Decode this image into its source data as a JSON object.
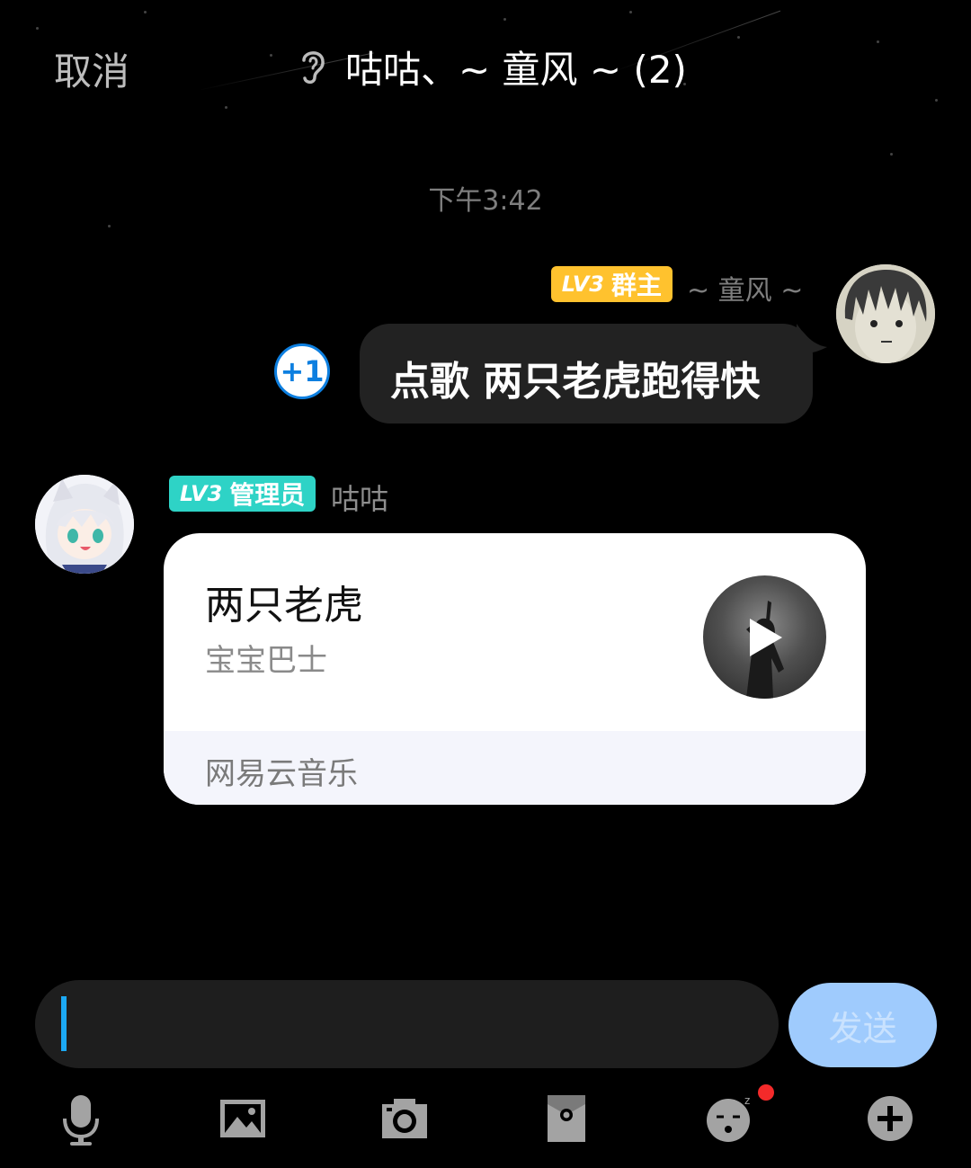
{
  "header": {
    "cancel_label": "取消",
    "title": "咕咕、~ 童风 ~ (2)"
  },
  "timestamp": "下午3:42",
  "messages": {
    "owner": {
      "badge_level": "LV3",
      "badge_role": "群主",
      "name": "~ 童风 ~",
      "text": "点歌 两只老虎跑得快",
      "plus_one": "+1"
    },
    "admin": {
      "badge_level": "LV3",
      "badge_role": "管理员",
      "name": "咕咕",
      "card": {
        "song_title": "两只老虎",
        "artist": "宝宝巴士",
        "source": "网易云音乐"
      }
    }
  },
  "composer": {
    "send_label": "发送"
  },
  "toolbar": {
    "icons": [
      "microphone-icon",
      "image-icon",
      "camera-icon",
      "red-packet-icon",
      "emoji-icon",
      "plus-icon"
    ],
    "emoji_has_notification": true
  },
  "colors": {
    "owner_badge": "#ffc22e",
    "admin_badge": "#2ed3c6",
    "plus_one": "#0d7fe0",
    "send_button": "#9fcbfd",
    "caret": "#1ca9f4",
    "notification_dot": "#f42a2a"
  }
}
